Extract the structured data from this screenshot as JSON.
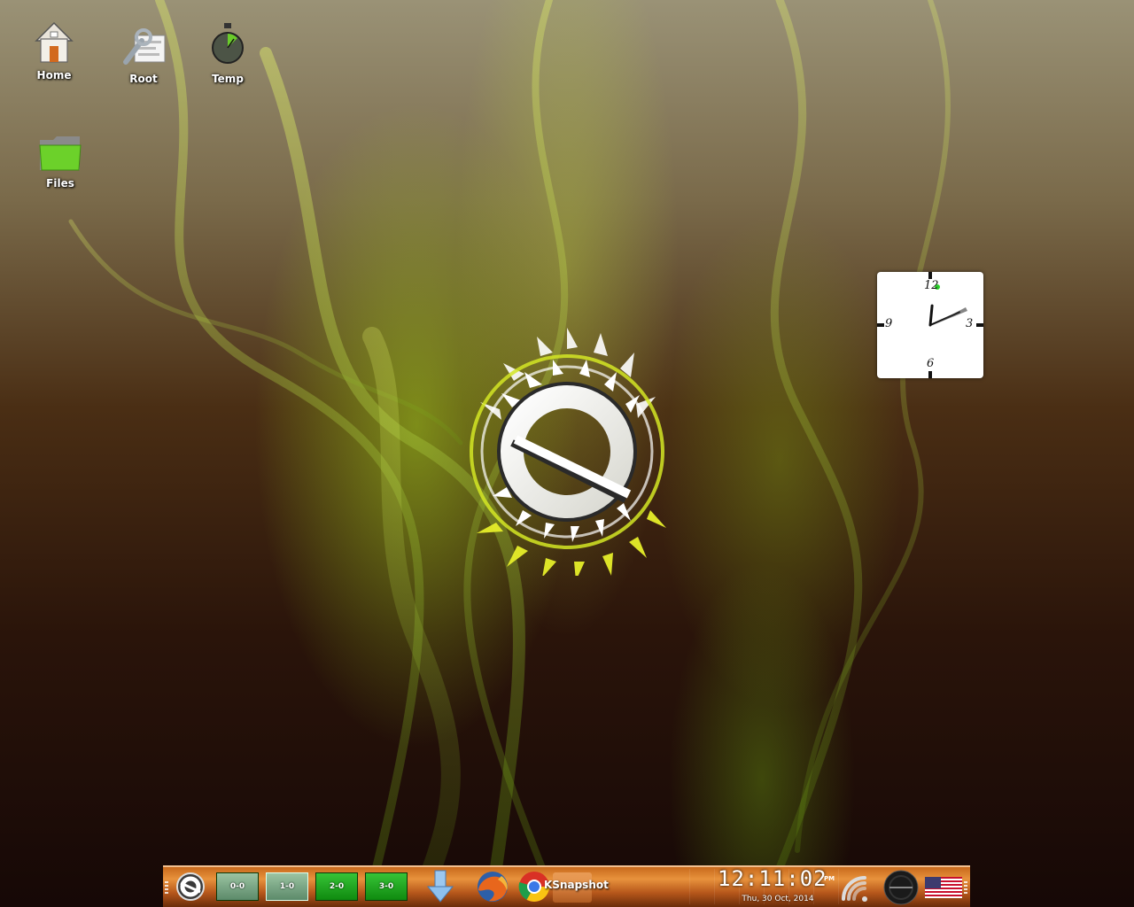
{
  "desktop": {
    "icons": [
      {
        "label": "Home",
        "icon": "home-icon"
      },
      {
        "label": "Root",
        "icon": "root-settings-icon"
      },
      {
        "label": "Temp",
        "icon": "stopwatch-icon"
      },
      {
        "label": "Files",
        "icon": "folder-icon"
      }
    ],
    "logo": "enlightenment-logo"
  },
  "clock_widget": {
    "numbers": {
      "twelve": "12",
      "three": "3",
      "six": "6",
      "nine": "9"
    },
    "hour": 12,
    "minute": 11,
    "second": 2
  },
  "shelf": {
    "start_icon": "enlightenment-start-icon",
    "pager": [
      {
        "label": "0-0"
      },
      {
        "label": "1-0"
      },
      {
        "label": "2-0"
      },
      {
        "label": "3-0"
      }
    ],
    "launchers": [
      {
        "icon": "download-arrow-icon"
      },
      {
        "icon": "firefox-icon"
      },
      {
        "icon": "chrome-icon"
      }
    ],
    "task": {
      "label": "KSnapshot"
    },
    "clock": {
      "time": "12:11:02",
      "ampm": "PM",
      "date": "Thu, 30 Oct, 2014"
    },
    "tray": [
      {
        "icon": "wifi-icon"
      },
      {
        "icon": "mixer-icon"
      },
      {
        "icon": "us-flag-icon"
      }
    ]
  },
  "colors": {
    "accent_green": "#9ad21e",
    "shelf_orange": "#e8923c"
  }
}
